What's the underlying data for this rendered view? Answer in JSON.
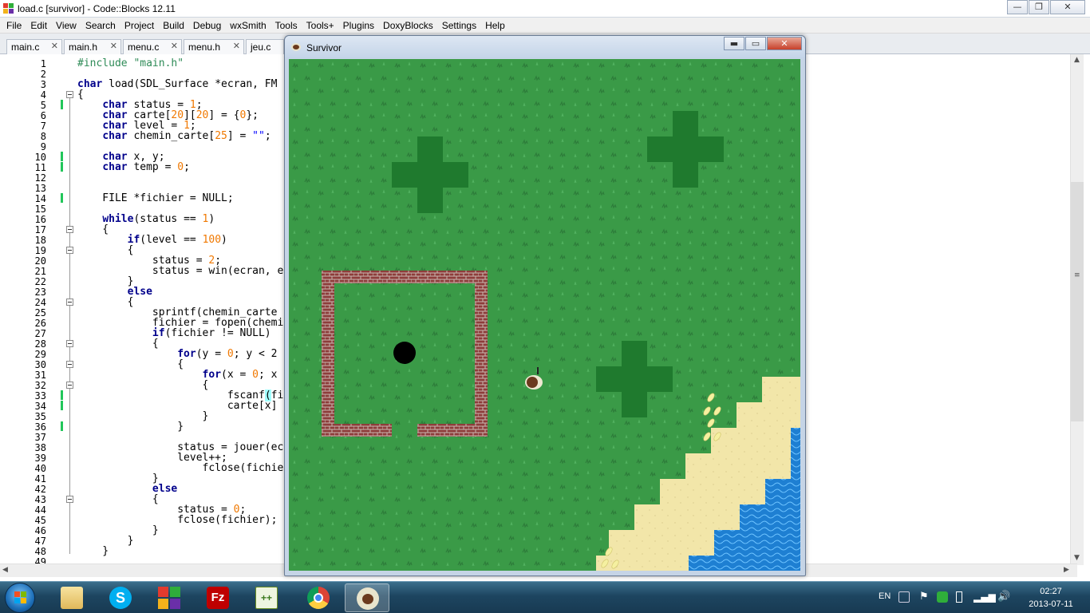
{
  "window": {
    "title": "load.c [survivor] - Code::Blocks 12.11",
    "minimize_glyph": "—",
    "maximize_glyph": "❐",
    "close_glyph": "✕"
  },
  "menu": [
    "File",
    "Edit",
    "View",
    "Search",
    "Project",
    "Build",
    "Debug",
    "wxSmith",
    "Tools",
    "Tools+",
    "Plugins",
    "DoxyBlocks",
    "Settings",
    "Help"
  ],
  "tabs": [
    {
      "label": "main.c"
    },
    {
      "label": "main.h"
    },
    {
      "label": "menu.c"
    },
    {
      "label": "menu.h"
    },
    {
      "label": "jeu.c"
    }
  ],
  "tab_close_glyph": "✕",
  "editor": {
    "lines": [
      {
        "n": "1"
      },
      {
        "n": "2"
      },
      {
        "n": "3"
      },
      {
        "n": "4"
      },
      {
        "n": "5"
      },
      {
        "n": "6"
      },
      {
        "n": "7"
      },
      {
        "n": "8"
      },
      {
        "n": "9"
      },
      {
        "n": "10"
      },
      {
        "n": "11"
      },
      {
        "n": "12"
      },
      {
        "n": "13"
      },
      {
        "n": "14"
      },
      {
        "n": "15"
      },
      {
        "n": "16"
      },
      {
        "n": "17"
      },
      {
        "n": "18"
      },
      {
        "n": "19"
      },
      {
        "n": "20"
      },
      {
        "n": "21"
      },
      {
        "n": "22"
      },
      {
        "n": "23"
      },
      {
        "n": "24"
      },
      {
        "n": "25"
      },
      {
        "n": "26"
      },
      {
        "n": "27"
      },
      {
        "n": "28"
      },
      {
        "n": "29"
      },
      {
        "n": "30"
      },
      {
        "n": "31"
      },
      {
        "n": "32"
      },
      {
        "n": "33"
      },
      {
        "n": "34"
      },
      {
        "n": "35"
      },
      {
        "n": "36"
      },
      {
        "n": "37"
      },
      {
        "n": "38"
      },
      {
        "n": "39"
      },
      {
        "n": "40"
      },
      {
        "n": "41"
      },
      {
        "n": "42"
      },
      {
        "n": "43"
      },
      {
        "n": "44"
      },
      {
        "n": "45"
      },
      {
        "n": "46"
      },
      {
        "n": "47"
      },
      {
        "n": "48"
      },
      {
        "n": "49"
      }
    ],
    "code": [
      [
        "1",
        [
          [
            "pp",
            "#include \"main.h\""
          ]
        ]
      ],
      [
        "3",
        [
          [
            "kw",
            "char"
          ],
          [
            "",
            " load(SDL_Surface *ecran, FM"
          ]
        ]
      ],
      [
        "4",
        [
          [
            "",
            "{"
          ]
        ]
      ],
      [
        "5",
        [
          [
            "",
            "    "
          ],
          [
            "kw",
            "char"
          ],
          [
            "",
            " status = "
          ],
          [
            "num",
            "1"
          ],
          [
            "",
            ";"
          ]
        ]
      ],
      [
        "6",
        [
          [
            "",
            "    "
          ],
          [
            "kw",
            "char"
          ],
          [
            "",
            " carte["
          ],
          [
            "num",
            "20"
          ],
          [
            "",
            "]["
          ],
          [
            "num",
            "20"
          ],
          [
            "",
            "] = {"
          ],
          [
            "num",
            "0"
          ],
          [
            "",
            "};"
          ]
        ]
      ],
      [
        "7",
        [
          [
            "",
            "    "
          ],
          [
            "kw",
            "char"
          ],
          [
            "",
            " level = "
          ],
          [
            "num",
            "1"
          ],
          [
            "",
            ";"
          ]
        ]
      ],
      [
        "8",
        [
          [
            "",
            "    "
          ],
          [
            "kw",
            "char"
          ],
          [
            "",
            " chemin_carte["
          ],
          [
            "num",
            "25"
          ],
          [
            "",
            "] = "
          ],
          [
            "str",
            "\"\""
          ],
          [
            "",
            ";"
          ]
        ]
      ],
      [
        "10",
        [
          [
            "",
            "    "
          ],
          [
            "kw",
            "char"
          ],
          [
            "",
            " x, y;"
          ]
        ]
      ],
      [
        "11",
        [
          [
            "",
            "    "
          ],
          [
            "kw",
            "char"
          ],
          [
            "",
            " temp = "
          ],
          [
            "num",
            "0"
          ],
          [
            "",
            ";"
          ]
        ]
      ],
      [
        "14",
        [
          [
            "",
            "    FILE *fichier = NULL;"
          ]
        ]
      ],
      [
        "16",
        [
          [
            "",
            "    "
          ],
          [
            "kw",
            "while"
          ],
          [
            "",
            "(status == "
          ],
          [
            "num",
            "1"
          ],
          [
            "",
            ")"
          ]
        ]
      ],
      [
        "17",
        [
          [
            "",
            "    {"
          ]
        ]
      ],
      [
        "18",
        [
          [
            "",
            "        "
          ],
          [
            "kw",
            "if"
          ],
          [
            "",
            "(level == "
          ],
          [
            "num",
            "100"
          ],
          [
            "",
            ")"
          ]
        ]
      ],
      [
        "19",
        [
          [
            "",
            "        {"
          ]
        ]
      ],
      [
        "20",
        [
          [
            "",
            "            status = "
          ],
          [
            "num",
            "2"
          ],
          [
            "",
            ";"
          ]
        ]
      ],
      [
        "21",
        [
          [
            "",
            "            status = win(ecran, e"
          ]
        ]
      ],
      [
        "22",
        [
          [
            "",
            "        }"
          ]
        ]
      ],
      [
        "23",
        [
          [
            "",
            "        "
          ],
          [
            "kw",
            "else"
          ]
        ]
      ],
      [
        "24",
        [
          [
            "",
            "        {"
          ]
        ]
      ],
      [
        "25",
        [
          [
            "",
            "            sprintf(chemin_carte"
          ]
        ]
      ],
      [
        "26",
        [
          [
            "",
            "            fichier = fopen(chemi"
          ]
        ]
      ],
      [
        "27",
        [
          [
            "",
            "            "
          ],
          [
            "kw",
            "if"
          ],
          [
            "",
            "(fichier != NULL)"
          ]
        ]
      ],
      [
        "28",
        [
          [
            "",
            "            {"
          ]
        ]
      ],
      [
        "29",
        [
          [
            "",
            "                "
          ],
          [
            "kw",
            "for"
          ],
          [
            "",
            "(y = "
          ],
          [
            "num",
            "0"
          ],
          [
            "",
            "; y < 2"
          ]
        ]
      ],
      [
        "30",
        [
          [
            "",
            "                {"
          ]
        ]
      ],
      [
        "31",
        [
          [
            "",
            "                    "
          ],
          [
            "kw",
            "for"
          ],
          [
            "",
            "(x = "
          ],
          [
            "num",
            "0"
          ],
          [
            "",
            "; x"
          ]
        ]
      ],
      [
        "32",
        [
          [
            "",
            "                    {"
          ]
        ]
      ],
      [
        "33",
        [
          [
            "",
            "                        fscanf"
          ],
          [
            "hl",
            "("
          ],
          [
            "",
            "fi"
          ]
        ]
      ],
      [
        "34",
        [
          [
            "",
            "                        carte[x]"
          ]
        ]
      ],
      [
        "35",
        [
          [
            "",
            "                    }"
          ]
        ]
      ],
      [
        "36",
        [
          [
            "",
            "                }"
          ]
        ]
      ],
      [
        "38",
        [
          [
            "",
            "                status = jouer(ec"
          ]
        ]
      ],
      [
        "39",
        [
          [
            "",
            "                level++;"
          ]
        ]
      ],
      [
        "40",
        [
          [
            "",
            "                    fclose(fichie"
          ]
        ]
      ],
      [
        "41",
        [
          [
            "",
            "            }"
          ]
        ]
      ],
      [
        "42",
        [
          [
            "",
            "            "
          ],
          [
            "kw",
            "else"
          ]
        ]
      ],
      [
        "43",
        [
          [
            "",
            "            {"
          ]
        ]
      ],
      [
        "44",
        [
          [
            "",
            "                status = "
          ],
          [
            "num",
            "0"
          ],
          [
            "",
            ";"
          ]
        ]
      ],
      [
        "45",
        [
          [
            "",
            "                fclose(fichier);"
          ]
        ]
      ],
      [
        "46",
        [
          [
            "",
            "            }"
          ]
        ]
      ],
      [
        "47",
        [
          [
            "",
            "        }"
          ]
        ]
      ],
      [
        "48",
        [
          [
            "",
            "    }"
          ]
        ]
      ]
    ],
    "changed_lines": [
      "5",
      "10",
      "11",
      "14",
      "33",
      "34",
      "36"
    ],
    "fold_lines": [
      "4",
      "17",
      "19",
      "24",
      "28",
      "30",
      "32",
      "43"
    ]
  },
  "game": {
    "title": "Survivor",
    "min_glyph": "▬",
    "max_glyph": "▭",
    "close_glyph": "✕",
    "colors": {
      "grass": "#3a9a47",
      "bush": "#1f7a2e",
      "wall": "#8e3d3b",
      "sand": "#f2e6a9",
      "water": "#1e7fd2",
      "hole": "#000000"
    }
  },
  "taskbar": {
    "apps": [
      {
        "name": "windows-explorer"
      },
      {
        "name": "skype"
      },
      {
        "name": "codeblocks"
      },
      {
        "name": "filezilla"
      },
      {
        "name": "notepad-plus-plus"
      },
      {
        "name": "chrome"
      },
      {
        "name": "survivor"
      }
    ],
    "lang": "EN",
    "time": "02:27",
    "date": "2013-07-11"
  }
}
